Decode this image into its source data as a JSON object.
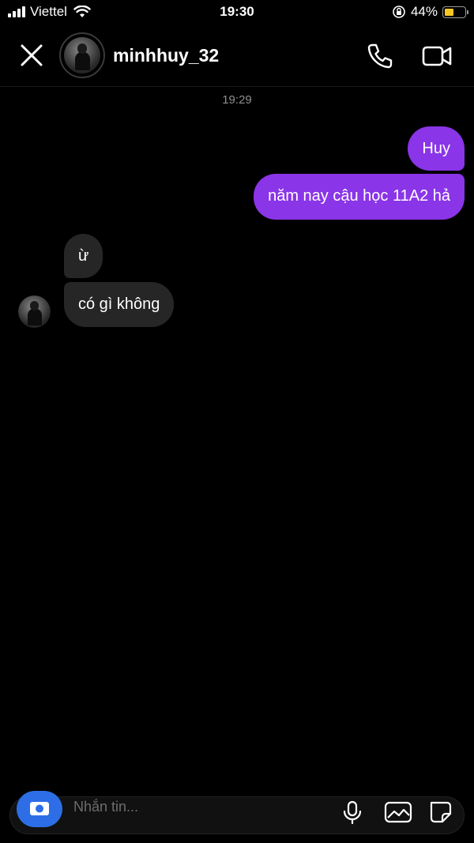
{
  "status_bar": {
    "carrier": "Viettel",
    "time": "19:30",
    "battery_percent": "44%",
    "battery_level": 0.44,
    "battery_color": "#f7c824",
    "icons": [
      "signal-icon",
      "wifi-icon",
      "rotation-lock-icon",
      "battery-icon"
    ]
  },
  "header": {
    "username": "minhhuy_32",
    "icons": [
      "close-icon",
      "avatar",
      "phone-icon",
      "video-camera-icon"
    ]
  },
  "conversation": {
    "timestamp": "19:29",
    "outgoing_color": "#8a35e8",
    "incoming_color": "#262626",
    "messages": [
      {
        "direction": "outgoing",
        "text": "Huy"
      },
      {
        "direction": "outgoing",
        "text": "năm nay cậu học 11A2 hả"
      },
      {
        "direction": "incoming",
        "text": "ừ"
      },
      {
        "direction": "incoming",
        "text": "có gì không"
      }
    ]
  },
  "composer": {
    "placeholder": "Nhắn tin...",
    "icons": [
      "camera-icon",
      "microphone-icon",
      "gallery-icon",
      "sticker-icon"
    ],
    "camera_color": "#2d6ee6"
  }
}
